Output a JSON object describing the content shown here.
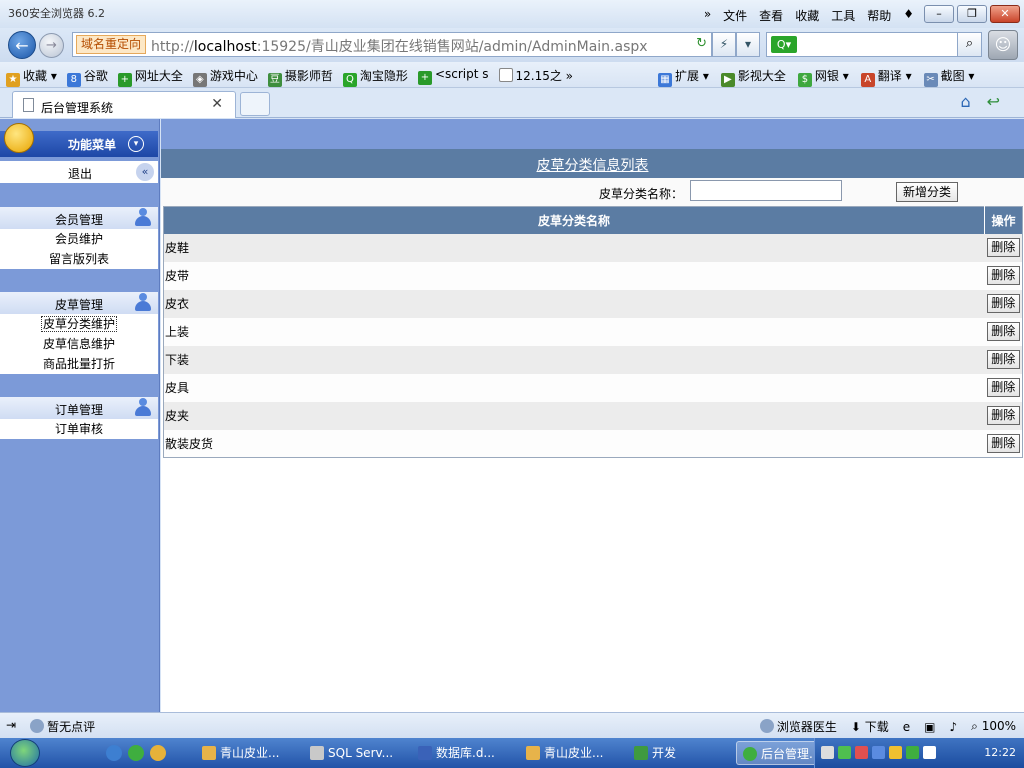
{
  "browser": {
    "app_title": "360安全浏览器 6.2",
    "menus": [
      "文件",
      "查看",
      "收藏",
      "工具",
      "帮助"
    ],
    "redirect_tag": "域名重定向",
    "url_prefix": "http://",
    "url_host": "localhost",
    "url_rest": ":15925/青山皮业集团在线销售网站/admin/AdminMain.aspx",
    "favorites_left": [
      "收藏",
      "谷歌",
      "网址大全",
      "游戏中心",
      "摄影师哲",
      "淘宝隐形",
      "<script s",
      "12.15之"
    ],
    "favorites_right": [
      "扩展",
      "影视大全",
      "网银",
      "翻译",
      "截图"
    ],
    "tab_label": "后台管理系统"
  },
  "sidebar": {
    "header": "功能菜单",
    "logout": "退出",
    "groups": [
      {
        "title": "会员管理",
        "items": [
          "会员维护",
          "留言版列表"
        ]
      },
      {
        "title": "皮草管理",
        "items": [
          "皮草分类维护",
          "皮草信息维护",
          "商品批量打折"
        ]
      },
      {
        "title": "订单管理",
        "items": [
          "订单审核"
        ]
      }
    ]
  },
  "main": {
    "list_title": "皮草分类信息列表",
    "filter_label": "皮草分类名称：",
    "filter_value": "",
    "add_button": "新增分类",
    "columns": [
      "皮草分类名称",
      "操作"
    ],
    "delete_label": "删除",
    "rows": [
      "皮鞋",
      "皮带",
      "皮衣",
      "上装",
      "下装",
      "皮具",
      "皮夹",
      "散装皮货"
    ]
  },
  "statusbar": {
    "left": "暂无点评",
    "doctor": "浏览器医生",
    "download": "下载",
    "zoom": "100%"
  },
  "taskbar": {
    "tasks": [
      "青山皮业...",
      "SQL Serv...",
      "数据库.d...",
      "青山皮业...",
      "开发",
      "后台管理..."
    ],
    "clock": "12:22"
  }
}
